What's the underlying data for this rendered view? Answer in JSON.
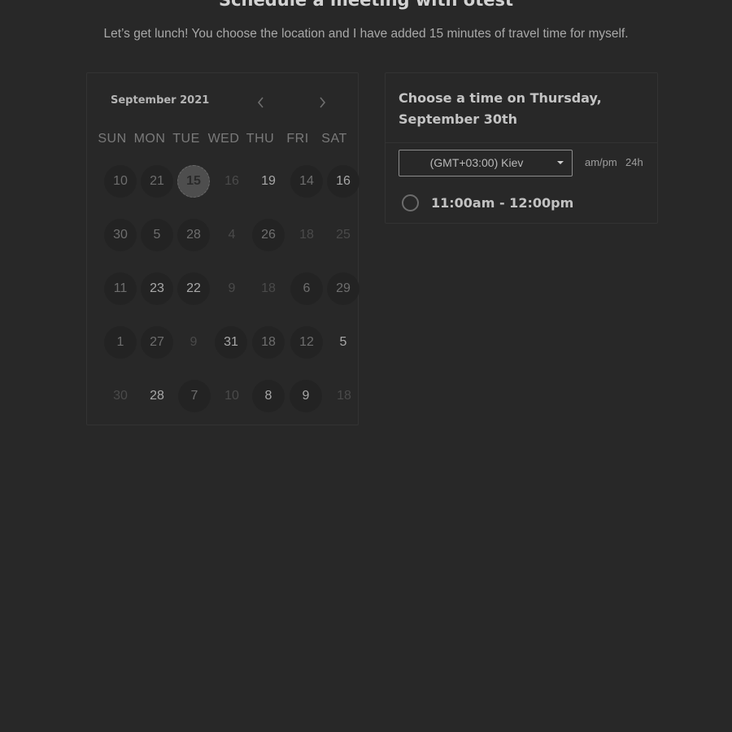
{
  "header": {
    "title": "Schedule a meeting with otest",
    "subtitle": "Let’s get lunch! You choose the location and I have added 15 minutes of travel time for myself."
  },
  "calendar": {
    "month_label": "September 2021",
    "prev_icon": "chevron-left-icon",
    "next_icon": "chevron-right-icon",
    "weekdays": [
      "SUN",
      "MON",
      "TUE",
      "WED",
      "THU",
      "FRI",
      "SAT"
    ],
    "weeks": [
      [
        "10",
        "21",
        "15",
        "16",
        "19",
        "14",
        "16"
      ],
      [
        "30",
        "5",
        "28",
        "4",
        "26",
        "18",
        "25"
      ],
      [
        "11",
        "23",
        "22",
        "9",
        "18",
        "6",
        "29"
      ],
      [
        "1",
        "27",
        "9",
        "31",
        "18",
        "12",
        "5"
      ],
      [
        "30",
        "28",
        "7",
        "10",
        "8",
        "9",
        "18"
      ]
    ]
  },
  "times": {
    "heading": "Choose a time on Thursday, September 30th",
    "timezone": "(GMT+03:00) Kiev",
    "format_ampm": "am/pm",
    "format_24h": "24h",
    "slots": [
      "11:00am - 12:00pm"
    ]
  },
  "colors": {
    "background": "#282828",
    "border": "#333333",
    "selected_day": "#4e4e4e"
  }
}
